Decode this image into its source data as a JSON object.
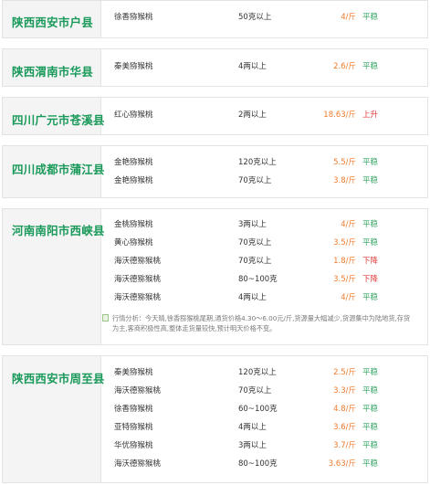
{
  "sections": [
    {
      "region": "陕西西安市户县",
      "items": [
        {
          "name": "徐香猕猴桃",
          "spec": "50克以上",
          "price": "4/斤",
          "trend": "平稳",
          "trend_color": "#2ea25f"
        }
      ]
    },
    {
      "region": "陕西渭南市华县",
      "items": [
        {
          "name": "秦美猕猴桃",
          "spec": "4两以上",
          "price": "2.6/斤",
          "trend": "平稳",
          "trend_color": "#2ea25f"
        }
      ]
    },
    {
      "region": "四川广元市苍溪县",
      "items": [
        {
          "name": "红心猕猴桃",
          "spec": "2两以上",
          "price": "18.63/斤",
          "trend": "上升",
          "trend_color": "#e23b3b"
        }
      ]
    },
    {
      "region": "四川成都市蒲江县",
      "items": [
        {
          "name": "金艳猕猴桃",
          "spec": "120克以上",
          "price": "5.5/斤",
          "trend": "平稳",
          "trend_color": "#2ea25f"
        },
        {
          "name": "金艳猕猴桃",
          "spec": "70克以上",
          "price": "3.8/斤",
          "trend": "平稳",
          "trend_color": "#2ea25f"
        }
      ]
    },
    {
      "region": "河南南阳市西峡县",
      "items": [
        {
          "name": "金桃猕猴桃",
          "spec": "3两以上",
          "price": "4/斤",
          "trend": "平稳",
          "trend_color": "#2ea25f"
        },
        {
          "name": "黄心猕猴桃",
          "spec": "70克以上",
          "price": "3.5/斤",
          "trend": "平稳",
          "trend_color": "#2ea25f"
        },
        {
          "name": "海沃德猕猴桃",
          "spec": "70克以上",
          "price": "1.8/斤",
          "trend": "下降",
          "trend_color": "#e23b3b"
        },
        {
          "name": "海沃德猕猴桃",
          "spec": "80~100克",
          "price": "3.5/斤",
          "trend": "下降",
          "trend_color": "#e23b3b"
        },
        {
          "name": "海沃德猕猴桃",
          "spec": "4两以上",
          "price": "4/斤",
          "trend": "平稳",
          "trend_color": "#2ea25f"
        }
      ],
      "analysis": "行情分析：今天晴,徐香猕猴桃尾期,通货价格4.30～6.00元/斤,货源量大幅减少,货源集中为陆地货,存货为主,客商积极性高,整体走货量较快,预计明天价格不变。"
    },
    {
      "region": "陕西西安市周至县",
      "items": [
        {
          "name": "秦美猕猴桃",
          "spec": "120克以上",
          "price": "2.5/斤",
          "trend": "平稳",
          "trend_color": "#2ea25f"
        },
        {
          "name": "海沃德猕猴桃",
          "spec": "70克以上",
          "price": "3.3/斤",
          "trend": "平稳",
          "trend_color": "#2ea25f"
        },
        {
          "name": "徐香猕猴桃",
          "spec": "60~100克",
          "price": "4.8/斤",
          "trend": "平稳",
          "trend_color": "#2ea25f"
        },
        {
          "name": "亚特猕猴桃",
          "spec": "4两以上",
          "price": "3.6/斤",
          "trend": "平稳",
          "trend_color": "#2ea25f"
        },
        {
          "name": "华优猕猴桃",
          "spec": "3两以上",
          "price": "3.7/斤",
          "trend": "平稳",
          "trend_color": "#2ea25f"
        },
        {
          "name": "海沃德猕猴桃",
          "spec": "80~100克",
          "price": "3.63/斤",
          "trend": "平稳",
          "trend_color": "#2ea25f"
        }
      ]
    }
  ]
}
